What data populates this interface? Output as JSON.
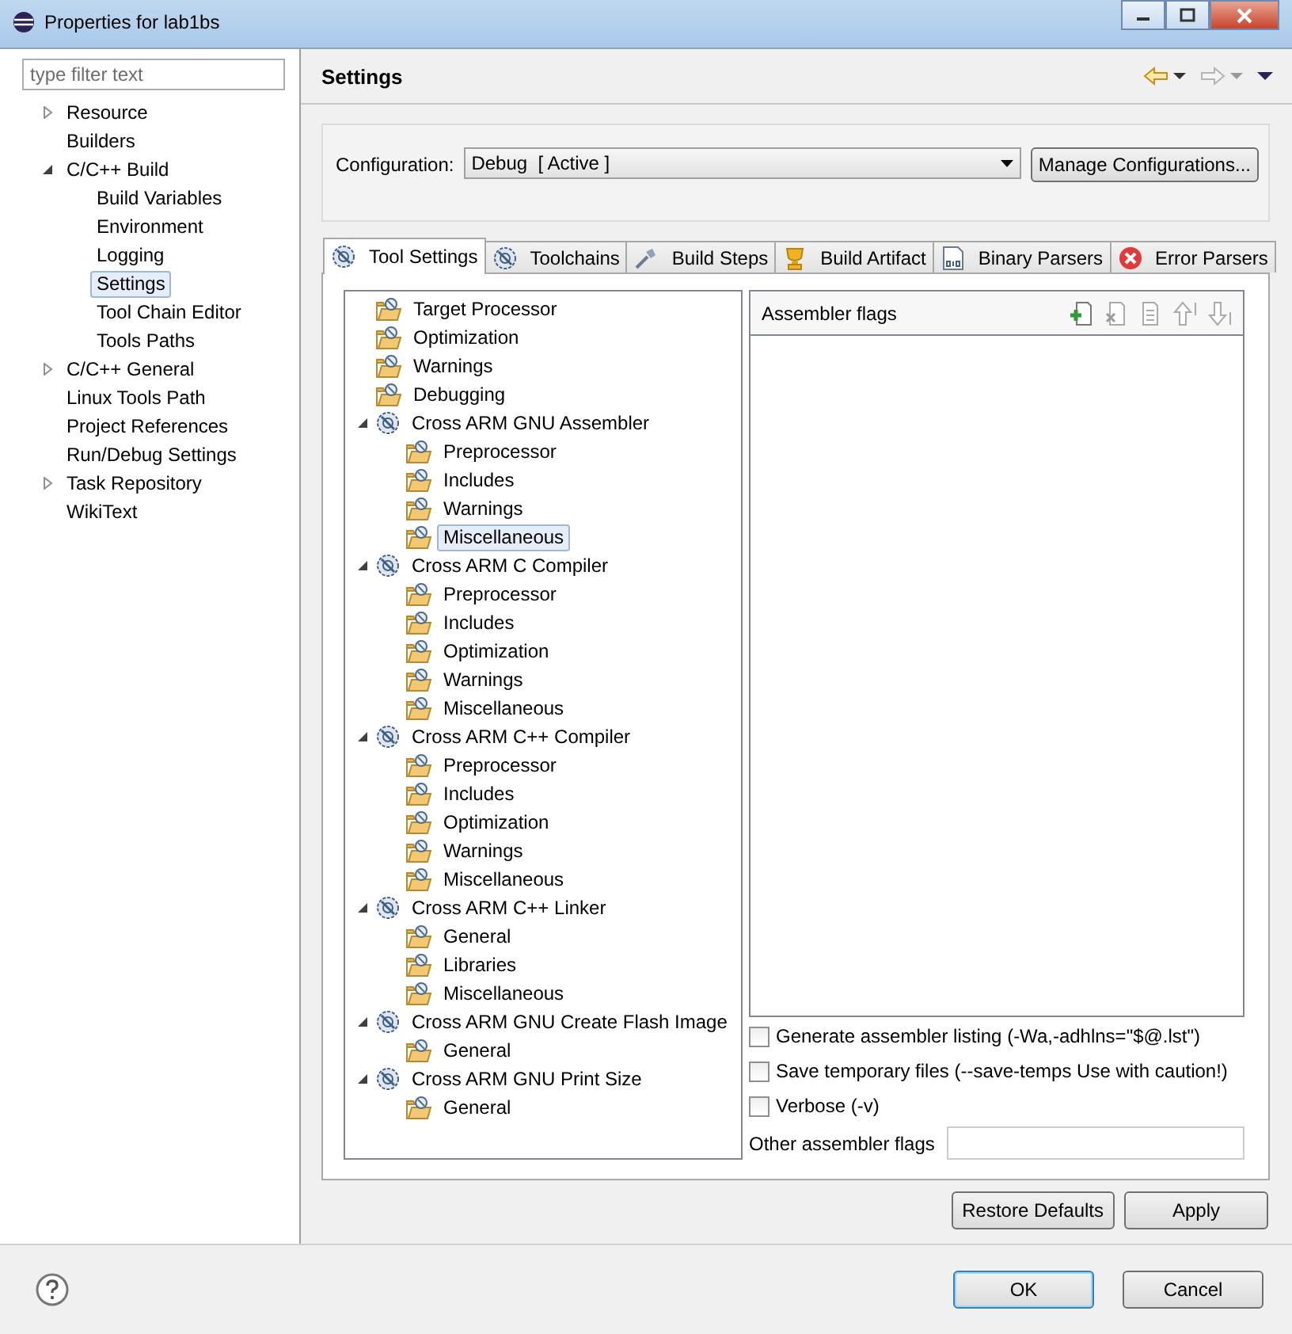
{
  "window": {
    "title": "Properties for lab1bs"
  },
  "filter": {
    "placeholder": "type filter text"
  },
  "nav": [
    {
      "label": "Resource",
      "expanded": false,
      "selected": false
    },
    {
      "label": "Builders",
      "selected": false
    },
    {
      "label": "C/C++ Build",
      "expanded": true,
      "selected": false,
      "children": [
        {
          "label": "Build Variables",
          "selected": false
        },
        {
          "label": "Environment",
          "selected": false
        },
        {
          "label": "Logging",
          "selected": false
        },
        {
          "label": "Settings",
          "selected": true
        },
        {
          "label": "Tool Chain Editor",
          "selected": false
        },
        {
          "label": "Tools Paths",
          "selected": false
        }
      ]
    },
    {
      "label": "C/C++ General",
      "expanded": false,
      "selected": false
    },
    {
      "label": "Linux Tools Path",
      "selected": false
    },
    {
      "label": "Project References",
      "selected": false
    },
    {
      "label": "Run/Debug Settings",
      "selected": false
    },
    {
      "label": "Task Repository",
      "expanded": false,
      "selected": false
    },
    {
      "label": "WikiText",
      "selected": false
    }
  ],
  "page": {
    "title": "Settings"
  },
  "configuration": {
    "label": "Configuration:",
    "value": "Debug  [ Active ]",
    "button": "Manage Configurations..."
  },
  "tabs": [
    {
      "label": "Tool Settings",
      "selected": true
    },
    {
      "label": "Toolchains",
      "selected": false
    },
    {
      "label": "Build Steps",
      "selected": false
    },
    {
      "label": "Build Artifact",
      "selected": false
    },
    {
      "label": "Binary Parsers",
      "selected": false
    },
    {
      "label": "Error Parsers",
      "selected": false
    }
  ],
  "tools": [
    {
      "kind": "category",
      "label": "Target Processor",
      "selected": false
    },
    {
      "kind": "category",
      "label": "Optimization",
      "selected": false
    },
    {
      "kind": "category",
      "label": "Warnings",
      "selected": false
    },
    {
      "kind": "category",
      "label": "Debugging",
      "selected": false
    },
    {
      "kind": "tool",
      "label": "Cross ARM GNU Assembler",
      "expanded": true,
      "selected": false,
      "children": [
        {
          "kind": "category",
          "label": "Preprocessor",
          "selected": false
        },
        {
          "kind": "category",
          "label": "Includes",
          "selected": false
        },
        {
          "kind": "category",
          "label": "Warnings",
          "selected": false
        },
        {
          "kind": "category",
          "label": "Miscellaneous",
          "selected": true
        }
      ]
    },
    {
      "kind": "tool",
      "label": "Cross ARM C Compiler",
      "expanded": true,
      "selected": false,
      "children": [
        {
          "kind": "category",
          "label": "Preprocessor",
          "selected": false
        },
        {
          "kind": "category",
          "label": "Includes",
          "selected": false
        },
        {
          "kind": "category",
          "label": "Optimization",
          "selected": false
        },
        {
          "kind": "category",
          "label": "Warnings",
          "selected": false
        },
        {
          "kind": "category",
          "label": "Miscellaneous",
          "selected": false
        }
      ]
    },
    {
      "kind": "tool",
      "label": "Cross ARM C++ Compiler",
      "expanded": true,
      "selected": false,
      "children": [
        {
          "kind": "category",
          "label": "Preprocessor",
          "selected": false
        },
        {
          "kind": "category",
          "label": "Includes",
          "selected": false
        },
        {
          "kind": "category",
          "label": "Optimization",
          "selected": false
        },
        {
          "kind": "category",
          "label": "Warnings",
          "selected": false
        },
        {
          "kind": "category",
          "label": "Miscellaneous",
          "selected": false
        }
      ]
    },
    {
      "kind": "tool",
      "label": "Cross ARM C++ Linker",
      "expanded": true,
      "selected": false,
      "children": [
        {
          "kind": "category",
          "label": "General",
          "selected": false
        },
        {
          "kind": "category",
          "label": "Libraries",
          "selected": false
        },
        {
          "kind": "category",
          "label": "Miscellaneous",
          "selected": false
        }
      ]
    },
    {
      "kind": "tool",
      "label": "Cross ARM GNU Create Flash Image",
      "expanded": true,
      "selected": false,
      "children": [
        {
          "kind": "category",
          "label": "General",
          "selected": false
        }
      ]
    },
    {
      "kind": "tool",
      "label": "Cross ARM GNU Print Size",
      "expanded": true,
      "selected": false,
      "children": [
        {
          "kind": "category",
          "label": "General",
          "selected": false
        }
      ]
    }
  ],
  "flags": {
    "title": "Assembler flags"
  },
  "options": [
    {
      "label": "Generate assembler listing (-Wa,-adhlns=\"$@.lst\")",
      "checked": false
    },
    {
      "label": "Save temporary files (--save-temps Use with caution!)",
      "checked": false
    },
    {
      "label": "Verbose (-v)",
      "checked": false
    }
  ],
  "other_flags": {
    "label": "Other assembler flags"
  },
  "buttons": {
    "restore": "Restore Defaults",
    "apply": "Apply",
    "ok": "OK",
    "cancel": "Cancel"
  }
}
